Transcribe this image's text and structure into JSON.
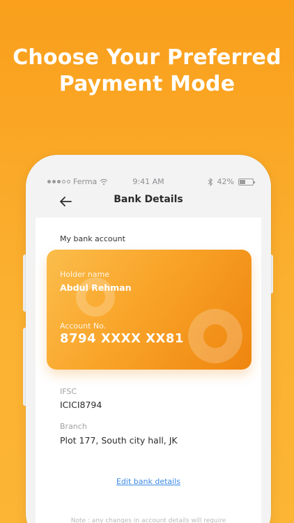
{
  "promo": {
    "headline_line1": "Choose Your Preferred",
    "headline_line2": "Payment Mode"
  },
  "status_bar": {
    "carrier": "Ferma",
    "time": "9:41 AM",
    "battery": "42%",
    "battery_level": 0.42
  },
  "nav": {
    "title": "Bank Details"
  },
  "bank": {
    "section_label": "My bank account",
    "holder_label": "Holder name",
    "holder_name": "Abdul Rehman",
    "account_label": "Account No.",
    "account_number": "8794 XXXX XX81",
    "ifsc_label": "IFSC",
    "ifsc_value": "ICICI8794",
    "branch_label": "Branch",
    "branch_value": "Plot 177, South city hall, JK",
    "edit_link": "Edit bank details",
    "note": "Note : any changes in account details will require"
  },
  "colors": {
    "background": "#f99f1c",
    "card_gradient_start": "#fbbd4b",
    "card_gradient_end": "#ee850f",
    "link": "#3d8ae6"
  }
}
